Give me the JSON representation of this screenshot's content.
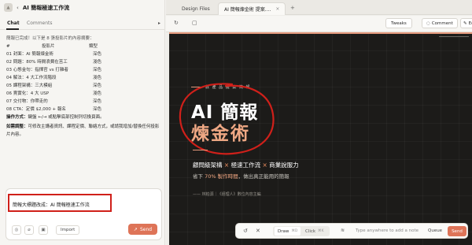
{
  "app": {
    "title": "AI 簡報極速工作流",
    "chevron": "‹"
  },
  "left_tabs": {
    "chat": "Chat",
    "comments": "Comments",
    "arrow": "▸"
  },
  "message": {
    "intro": "簡報已完成！以下是 8 張投影片的內容摘要：",
    "headers": [
      "#",
      "投影片",
      "類型"
    ],
    "rows": [
      [
        "01 封面：AI 簡報煉金術",
        "深色"
      ],
      [
        "02 問題：80% 時間浪費在苦工",
        "淺色"
      ],
      [
        "03 心態金句：指揮官 vs 打雜者",
        "深色"
      ],
      [
        "04 解法：4 大工作流階段",
        "淺色"
      ],
      [
        "05 課程架構：三大模組",
        "深色"
      ],
      [
        "06 賣實化：4 大 USP",
        "淺色"
      ],
      [
        "07 交付物：你帶走的",
        "深色"
      ],
      [
        "08 CTA：定價 $2,000 + 報名",
        "深色"
      ]
    ],
    "operation_label": "操作方式：",
    "operation_text": "鍵盤 ←/→ 或點擊底部控制列切換頁面。",
    "adjust_label": "如需調整：",
    "adjust_text": "可修改主講者資訊、課程定價、聯絡方式，或請我增加/替換任何投影片內容。"
  },
  "composer": {
    "input_value": "簡報大標題改成：AI 簡報極速工作流",
    "import_label": "Import",
    "send_label": "Send"
  },
  "file_tabs": [
    {
      "label": "Design Files"
    },
    {
      "label": "AI 簡報煉金術 提案...."
    }
  ],
  "toolbar": {
    "tweaks": "Tweaks",
    "comment": "Comment",
    "edit": "Ed"
  },
  "slide": {
    "eyebrow": "教 產 品 提 案 簡 報",
    "title_line1": "AI 簡報",
    "title_line2": "煉金術",
    "tagline_a": "顧問級架構",
    "tagline_x": "×",
    "tagline_b": "極速工作流",
    "tagline_c": "商業說服力",
    "sub_a": "省下",
    "sub_b": "70% 製作時間",
    "sub_c": "，做出真正能用的簡報",
    "author": "—— 林柏源｜《經理人》數位內容主編"
  },
  "bottom_bar": {
    "draw": "Draw",
    "draw_key": "⌘D",
    "click": "Click",
    "click_key": "⌘K",
    "note_placeholder": "Type anywhere to add a note",
    "queue": "Queue",
    "send": "Send"
  },
  "colors": {
    "accent": "#de7458",
    "highlight_red": "#d0201a",
    "slide_bg": "#1c1b19",
    "slide_orange": "#efa884"
  }
}
